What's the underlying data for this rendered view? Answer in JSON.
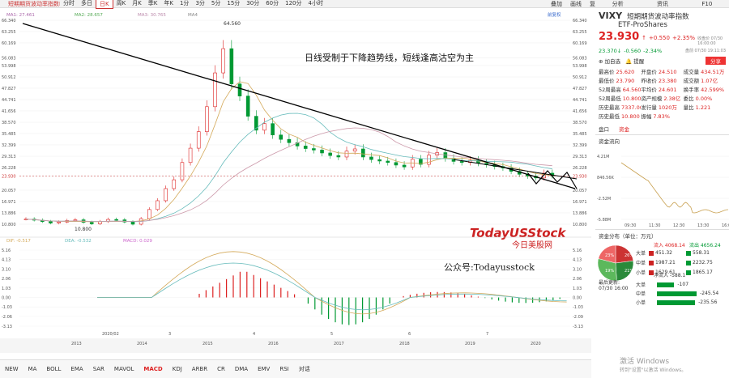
{
  "toolbar": {
    "title": "短期期货波动率指数ETF",
    "periods": [
      "分时",
      "多日",
      "日K",
      "周K",
      "月K",
      "季K",
      "年K",
      "1分",
      "3分",
      "5分",
      "15分",
      "30分",
      "60分",
      "120分",
      "4小时"
    ],
    "active": "日K",
    "right": [
      "叠加",
      "画线",
      "复权",
      "全屏"
    ]
  },
  "price_axis": [
    "66.340",
    "63.255",
    "60.169",
    "56.083",
    "53.998",
    "50.912",
    "47.827",
    "44.741",
    "41.656",
    "38.570",
    "35.485",
    "32.399",
    "29.313",
    "26.228",
    "23.930",
    "20.057",
    "16.971",
    "13.886",
    "10.800"
  ],
  "ma_legend": {
    "ma1": "MA1: 27.461",
    "ma2": "MA2: 28.657",
    "ma3": "MA3: 30.765",
    "ma4": "MA4"
  },
  "adjust_label": "前复权",
  "high_label": "64.560",
  "low_label": "10.800",
  "current_label": "23.930",
  "annotation": "日线受制于下降趋势线，短线逢高沽空为主",
  "macd_legend": {
    "dif": "DIF: -0.517",
    "dea": "DEA: -0.532",
    "macd": "MACD: 0.029"
  },
  "macd_axis": [
    "5.16",
    "4.13",
    "3.10",
    "2.06",
    "1.03",
    "0.00",
    "-1.03",
    "-2.06",
    "-3.13"
  ],
  "macd_axis_right": [
    "5.16",
    "4.13",
    "3.10",
    "2.06",
    "1.03",
    "0.00",
    "-1.03",
    "-2.09",
    "-3.13"
  ],
  "macd_labels": [
    "2020/02",
    "3",
    "4",
    "5",
    "6",
    "7"
  ],
  "years": [
    "2013",
    "2014",
    "2015",
    "2016",
    "2017",
    "2018",
    "2019",
    "2020"
  ],
  "watermark": {
    "brand": "TodayUSStock",
    "cn": "今日美股网",
    "wechat": "公众号:Todayusstock"
  },
  "bottom_tabs": [
    "NEW",
    "MA",
    "BOLL",
    "EMA",
    "SAR",
    "MAVOL",
    "MACD",
    "KDJ",
    "ARBR",
    "CR",
    "DMA",
    "EMV",
    "RSI",
    "对话"
  ],
  "bottom_active": "MACD",
  "side": {
    "tabs": [
      "分析",
      "资讯",
      "F10"
    ],
    "ticker": "VIXY",
    "name": "短期期货波动率指数",
    "name2": "ETF-ProShares",
    "price": "23.930",
    "arrow": "↑",
    "chg": "+0.550",
    "pct": "+2.35%",
    "date1": "收盘价 07/30 16:00:00",
    "pre": "23.370↓",
    "prechg": "-0.560",
    "prepct": "-2.34%",
    "date2": "盘前 07/30 19:11:03",
    "add": "加自选",
    "alert": "提醒",
    "share": "分享",
    "quotes": [
      [
        "最高价",
        "25.620",
        "开盘价",
        "24.510",
        "成交量",
        "434.51万"
      ],
      [
        "最低价",
        "23.790",
        "昨收价",
        "23.380",
        "成交额",
        "1.07亿"
      ],
      [
        "52周最高",
        "64.560",
        "平均价",
        "24.601",
        "换手率",
        "42.599%"
      ],
      [
        "52周最低",
        "10.800",
        "资产规模",
        "2.38亿",
        "委比",
        "0.00%"
      ],
      [
        "历史最高",
        "7337.00",
        "发行量",
        "1020万",
        "量比",
        "1.221"
      ],
      [
        "历史最低",
        "10.800",
        "振幅",
        "7.83%",
        "",
        ""
      ]
    ],
    "flow_tabs": [
      "盘口",
      "资金"
    ],
    "flow_title": "资金流向",
    "flow_axis": [
      "4.21M",
      "846.56K",
      "-2.52M",
      "-5.88M"
    ],
    "flow_x": [
      "09:30",
      "11:30",
      "12:30",
      "13:30",
      "16:00"
    ],
    "dist_title": "资金分布（单位：万元）",
    "in_label": "流入 4068.14",
    "out_label": "流出 4656.24",
    "pie": [
      "23%",
      "26%",
      "19%",
      "21%"
    ],
    "rows": [
      [
        "大单",
        "451.32",
        "558.31"
      ],
      [
        "中单",
        "1987.21",
        "2232.75"
      ],
      [
        "小单",
        "1629.61",
        "1865.17"
      ]
    ],
    "net_label": "净流入 -588.1",
    "update": "最后更新:",
    "update_time": "07/30 16:00",
    "net": [
      [
        "大单",
        "-107"
      ],
      [
        "中单",
        "-245.54"
      ],
      [
        "小单",
        "-235.56"
      ]
    ]
  },
  "windows": {
    "line1": "激活 Windows",
    "line2": "转到\"设置\"以激活 Windows。"
  },
  "chart_data": {
    "type": "candlestick",
    "approx_close": [
      12.2,
      11.9,
      11.5,
      11.1,
      11.4,
      11.8,
      12.0,
      11.3,
      10.9,
      11.5,
      12.1,
      12.0,
      11.4,
      10.8,
      12.3,
      14.8,
      17.2,
      20.5,
      22.9,
      27.6,
      31.5,
      36.0,
      42.8,
      52.0,
      58.6,
      49.0,
      45.7,
      40.2,
      36.4,
      38.2,
      35.1,
      33.9,
      33.0,
      32.1,
      31.4,
      31.0,
      30.2,
      29.5,
      29.1,
      30.7,
      31.3,
      29.1,
      28.4,
      28.0,
      27.6,
      26.9,
      26.4,
      28.5,
      27.1,
      29.6,
      30.3,
      28.7,
      27.9,
      27.6,
      28.2,
      27.4,
      27.0,
      26.5,
      26.1,
      25.2,
      24.4,
      23.9,
      23.4,
      24.7,
      23.93
    ],
    "high": 64.56,
    "low": 10.8,
    "last": 23.93
  }
}
